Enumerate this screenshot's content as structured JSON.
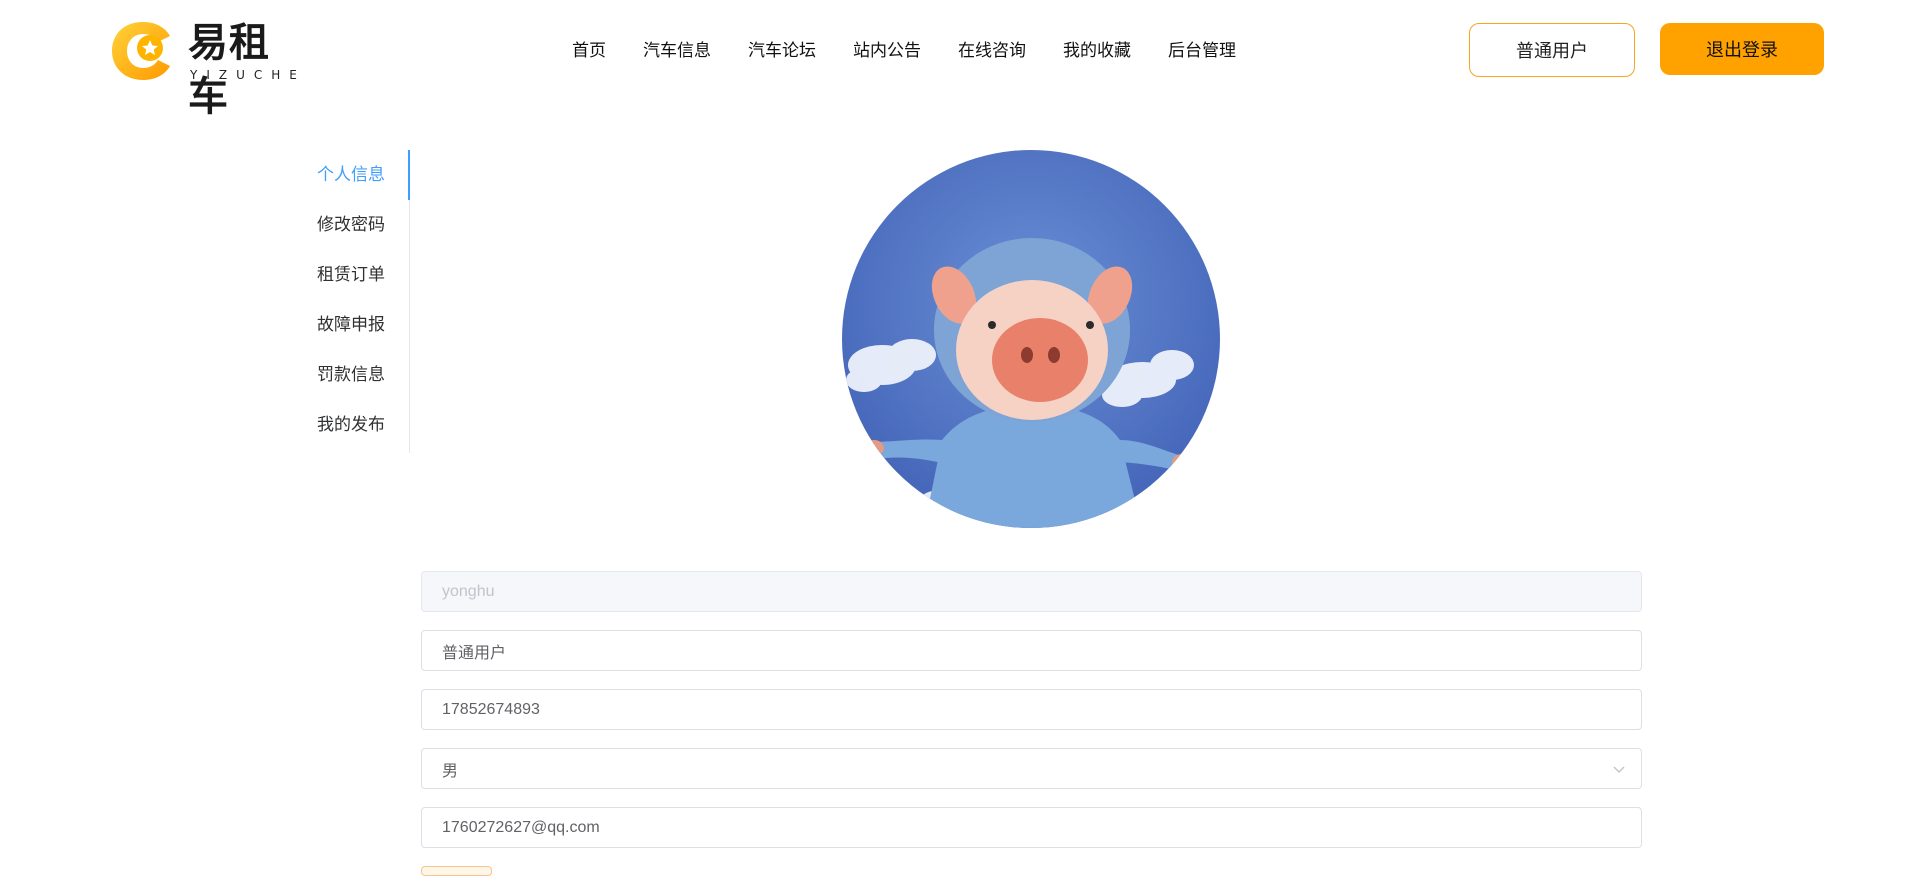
{
  "header": {
    "logo_title": "易租车",
    "logo_sub": "YIZUCHE",
    "nav": [
      "首页",
      "汽车信息",
      "汽车论坛",
      "站内公告",
      "在线咨询",
      "我的收藏",
      "后台管理"
    ],
    "user_button": "普通用户",
    "logout_button": "退出登录"
  },
  "sidebar": {
    "items": [
      {
        "label": "个人信息",
        "active": true
      },
      {
        "label": "修改密码",
        "active": false
      },
      {
        "label": "租赁订单",
        "active": false
      },
      {
        "label": "故障申报",
        "active": false
      },
      {
        "label": "罚款信息",
        "active": false
      },
      {
        "label": "我的发布",
        "active": false
      }
    ]
  },
  "form": {
    "username": "yonghu",
    "role": "普通用户",
    "phone": "17852674893",
    "gender": "男",
    "email": "1760272627@qq.com"
  },
  "colors": {
    "accent": "#ffa200",
    "active_menu": "#409eff"
  },
  "icons": {
    "logo": "logo-icon",
    "select": "chevron-down-icon"
  }
}
